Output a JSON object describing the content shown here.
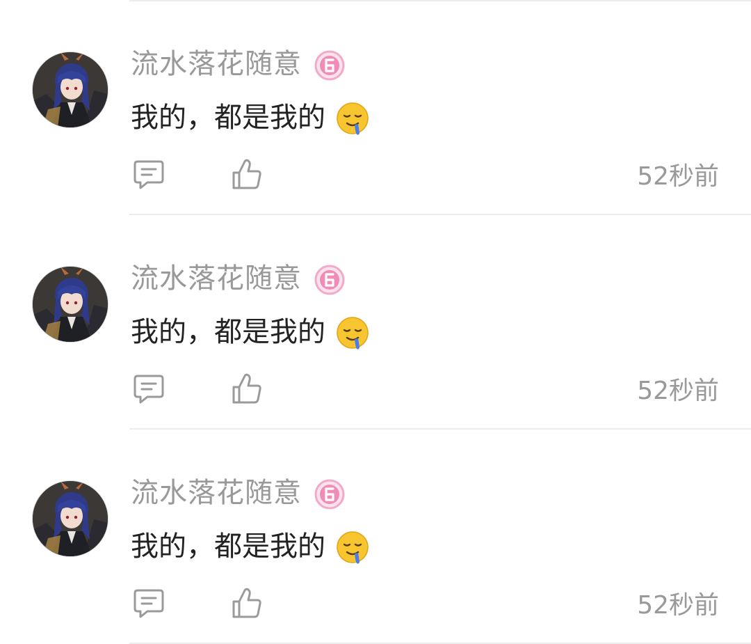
{
  "comments": [
    {
      "username": "流水落花随意",
      "text": "我的，都是我的",
      "emoji": "drooling-face-emoji",
      "time": "52秒前"
    },
    {
      "username": "流水落花随意",
      "text": "我的，都是我的",
      "emoji": "drooling-face-emoji",
      "time": "52秒前"
    },
    {
      "username": "流水落花随意",
      "text": "我的，都是我的",
      "emoji": "drooling-face-emoji",
      "time": "52秒前"
    }
  ],
  "icons": {
    "reply": "comment-reply-icon",
    "like": "thumbs-up-icon",
    "badge": "user-level-badge-icon"
  },
  "colors": {
    "username": "#999999",
    "text": "#222222",
    "time": "#999999",
    "badge": "#f08cb8",
    "divider": "#ececec"
  }
}
